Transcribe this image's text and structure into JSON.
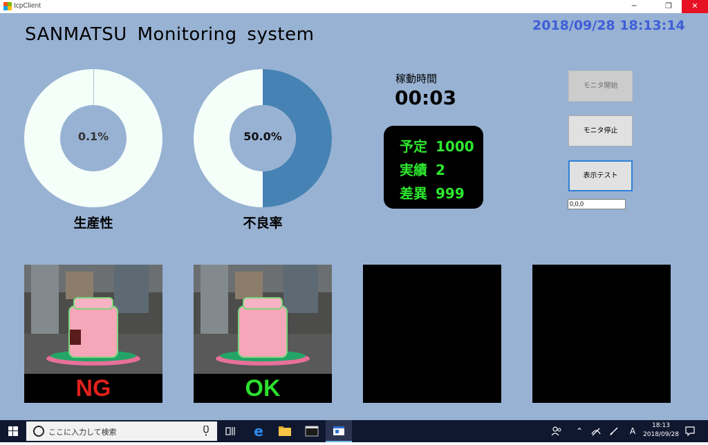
{
  "window": {
    "title": "tcpClient",
    "minimize": "─",
    "maximize": "❐",
    "close": "✕"
  },
  "header": {
    "title": "SANMATSU  Monitoring  system",
    "datetime": "2018/09/28 18:13:14"
  },
  "gauges": [
    {
      "label": "生産性",
      "value_text": "0.1%",
      "value": 0.001,
      "fill_color": "#4682b4",
      "ring_color": "#f5fffa",
      "text_color": "#333333"
    },
    {
      "label": "不良率",
      "value_text": "50.0%",
      "value": 0.5,
      "fill_color": "#4682b4",
      "ring_color": "#f5fffa",
      "text_color": "#111111"
    }
  ],
  "runtime": {
    "label": "稼動時間",
    "value": "00:03"
  },
  "counter": {
    "rows": [
      {
        "label": "予定",
        "value": "1000"
      },
      {
        "label": "実績",
        "value": "2"
      },
      {
        "label": "差異",
        "value": "999"
      }
    ],
    "color": "#2de82d"
  },
  "controls": {
    "start_button": "モニタ開始",
    "stop_button": "モニタ停止",
    "test_button": "表示テスト",
    "input_value": "0,0,0"
  },
  "cameras": [
    {
      "result": "NG",
      "result_color": "#e0201c"
    },
    {
      "result": "OK",
      "result_color": "#2ddf2d"
    },
    {
      "result": ""
    },
    {
      "result": ""
    }
  ],
  "taskbar": {
    "search_placeholder": "ここに入力して検索",
    "ime": "A",
    "clock_time": "18:13",
    "clock_date": "2018/09/28"
  }
}
